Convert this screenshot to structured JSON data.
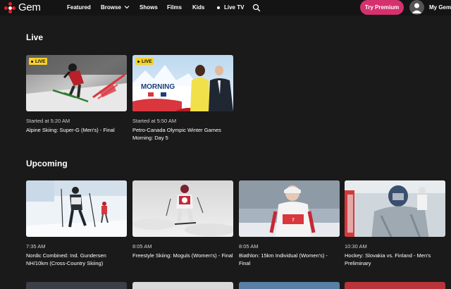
{
  "nav": {
    "logo_text": "Gem",
    "featured": "Featured",
    "browse": "Browse",
    "shows": "Shows",
    "films": "Films",
    "kids": "Kids",
    "live_tv": "Live TV",
    "try_premium": "Try Premium",
    "my_gem": "My Gem"
  },
  "live": {
    "title": "Live",
    "badge": "LIVE",
    "items": [
      {
        "time": "Started at 5:20 AM",
        "title": "Alpine Skiing: Super-G (Men's) - Final"
      },
      {
        "time": "Started at 5:50 AM",
        "title": "Petro-Canada Olympic Winter Games Morning: Day 5",
        "thumb_text": "MORNING"
      }
    ]
  },
  "upcoming": {
    "title": "Upcoming",
    "items": [
      {
        "time": "7:35 AM",
        "title": "Nordic Combined: Ind. Gundersen NH/10km (Cross-Country Skiing)"
      },
      {
        "time": "8:05 AM",
        "title": "Freestyle Skiing: Moguls (Women's) - Final"
      },
      {
        "time": "8:05 AM",
        "title": "Biathlon: 15km Individual (Women's) - Final"
      },
      {
        "time": "10:30 AM",
        "title": "Hockey: Slovakia vs. Finland - Men's Preliminary"
      }
    ]
  },
  "colors": {
    "background": "#1a1a1a",
    "accent_premium": "#d6316f",
    "live_badge": "#f5d12b",
    "brand_red": "#e01f26"
  }
}
